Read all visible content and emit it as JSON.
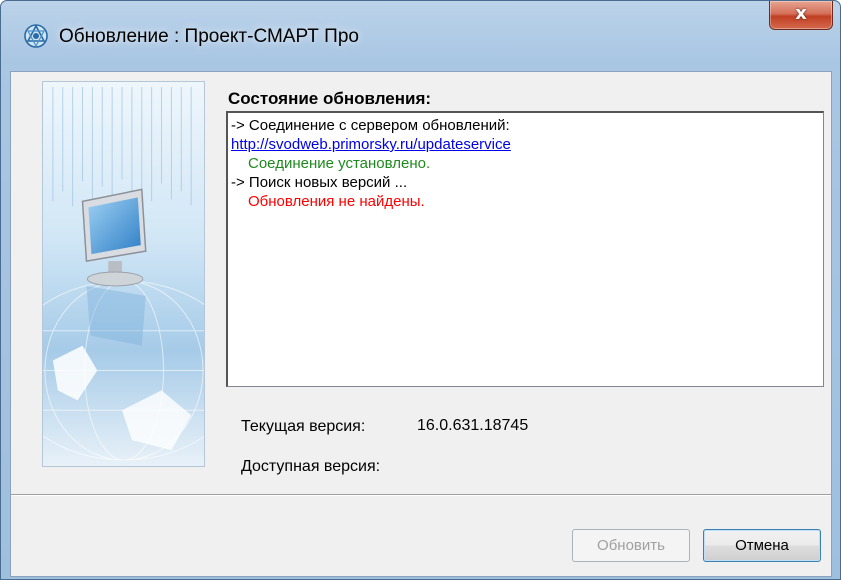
{
  "window": {
    "title": "Обновление : Проект-СМАРТ Про",
    "close_glyph": "x"
  },
  "icons": {
    "app": "globe-update-icon",
    "close": "close-icon"
  },
  "update_status": {
    "heading": "Состояние обновления:",
    "log": [
      {
        "text": "-> Соединение с сервером обновлений:",
        "kind": "normal"
      },
      {
        "text": "http://svodweb.primorsky.ru/updateservice",
        "kind": "link"
      },
      {
        "text": "Соединение установлено.",
        "kind": "success"
      },
      {
        "text": "-> Поиск новых версий ...",
        "kind": "normal"
      },
      {
        "text": "Обновления не найдены.",
        "kind": "error"
      }
    ]
  },
  "versions": {
    "current_label": "Текущая версия:",
    "current_value": "16.0.631.18745",
    "available_label": "Доступная версия:",
    "available_value": ""
  },
  "buttons": {
    "update_label": "Обновить",
    "cancel_label": "Отмена"
  },
  "colors": {
    "link": "#0000ee",
    "success": "#1e8a1e",
    "error": "#ff0000"
  }
}
